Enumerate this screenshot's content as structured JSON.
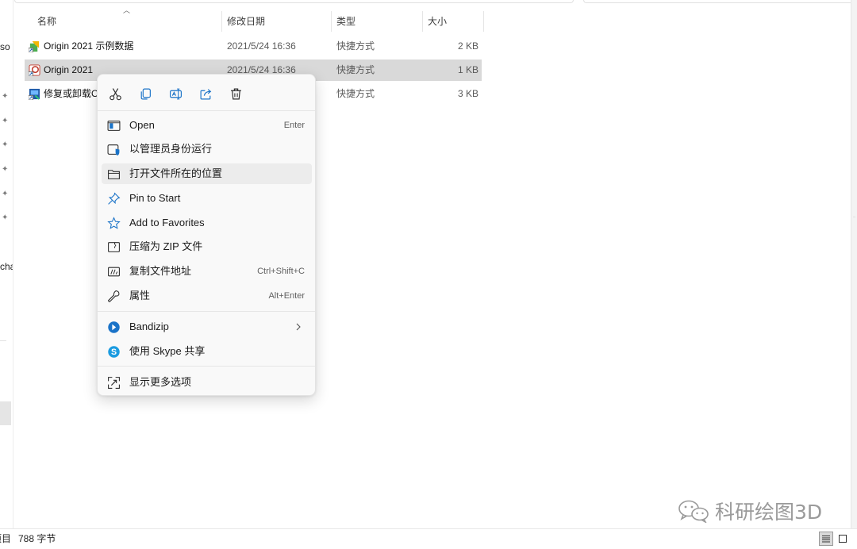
{
  "nav": {
    "fragments": [
      "so",
      "cha"
    ],
    "status_prefix": "项目"
  },
  "columns": {
    "name": "名称",
    "date": "修改日期",
    "type": "类型",
    "size": "大小"
  },
  "files": [
    {
      "name": "Origin 2021 示例数据",
      "date": "2021/5/24 16:36",
      "type": "快捷方式",
      "size": "2 KB",
      "icon": "origin-sample-shortcut-icon"
    },
    {
      "name": "Origin 2021",
      "date": "2021/5/24 16:36",
      "type": "快捷方式",
      "size": "1 KB",
      "icon": "origin-app-icon",
      "selected": true
    },
    {
      "name": "修复或卸载O",
      "date": "",
      "type": "快捷方式",
      "size": "3 KB",
      "icon": "repair-uninstall-icon"
    }
  ],
  "context_menu": {
    "quick_actions": [
      "cut-icon",
      "copy-icon",
      "rename-icon",
      "share-icon",
      "delete-icon"
    ],
    "items": [
      {
        "label": "Open",
        "shortcut": "Enter",
        "icon": "open-icon"
      },
      {
        "label": "以管理员身份运行",
        "shortcut": "",
        "icon": "run-as-admin-icon"
      },
      {
        "label": "打开文件所在的位置",
        "shortcut": "",
        "icon": "folder-icon",
        "hover": true
      },
      {
        "label": "Pin to Start",
        "shortcut": "",
        "icon": "pin-icon"
      },
      {
        "label": "Add to Favorites",
        "shortcut": "",
        "icon": "star-icon"
      },
      {
        "label": "压缩为 ZIP 文件",
        "shortcut": "",
        "icon": "zip-icon"
      },
      {
        "label": "复制文件地址",
        "shortcut": "Ctrl+Shift+C",
        "icon": "copy-path-icon"
      },
      {
        "label": "属性",
        "shortcut": "Alt+Enter",
        "icon": "wrench-icon"
      },
      {
        "label": "Bandizip",
        "shortcut": "",
        "icon": "bandizip-icon",
        "submenu": true
      },
      {
        "label": "使用 Skype 共享",
        "shortcut": "",
        "icon": "skype-icon"
      },
      {
        "label": "显示更多选项",
        "shortcut": "",
        "icon": "more-options-icon"
      }
    ]
  },
  "status_bar": {
    "size_text": "788 字节"
  },
  "watermark": {
    "text": "科研绘图3D"
  },
  "colors": {
    "selected_row": "#d9d9d9",
    "menu_bg": "#f9f9f9",
    "accent_blue": "#1a73c8"
  }
}
